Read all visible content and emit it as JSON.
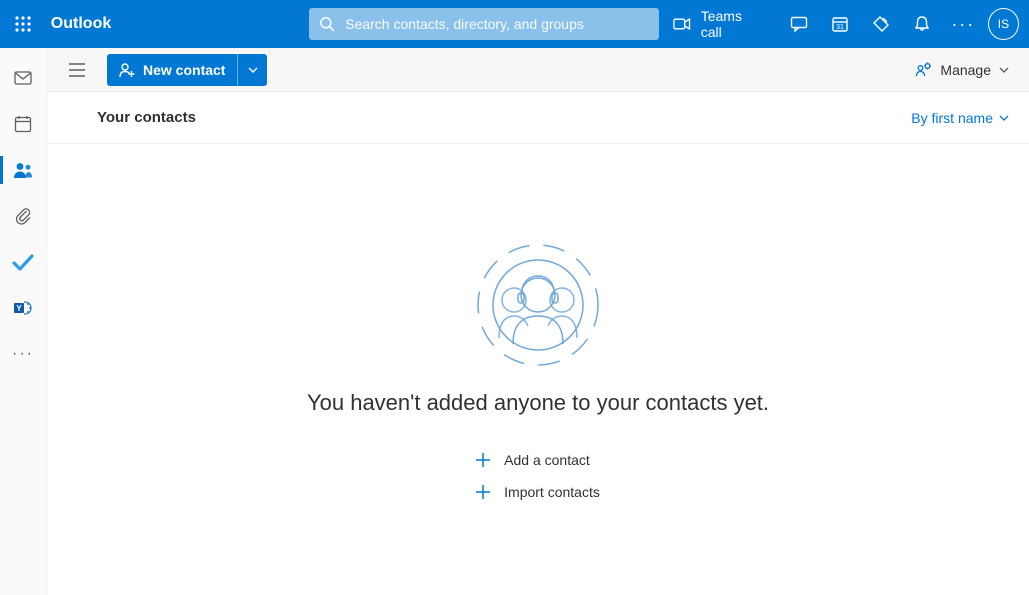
{
  "header": {
    "brand": "Outlook",
    "search_placeholder": "Search contacts, directory, and groups",
    "teams_call_label": "Teams call",
    "avatar_initials": "IS"
  },
  "rail": {
    "items": [
      {
        "name": "mail"
      },
      {
        "name": "calendar"
      },
      {
        "name": "people"
      },
      {
        "name": "files"
      },
      {
        "name": "todo"
      },
      {
        "name": "yammer"
      }
    ]
  },
  "cmdbar": {
    "new_contact_label": "New contact",
    "manage_label": "Manage"
  },
  "page": {
    "title": "Your contacts",
    "sort_label": "By first name"
  },
  "empty": {
    "message": "You haven't added anyone to your contacts yet.",
    "add_label": "Add a contact",
    "import_label": "Import contacts"
  }
}
